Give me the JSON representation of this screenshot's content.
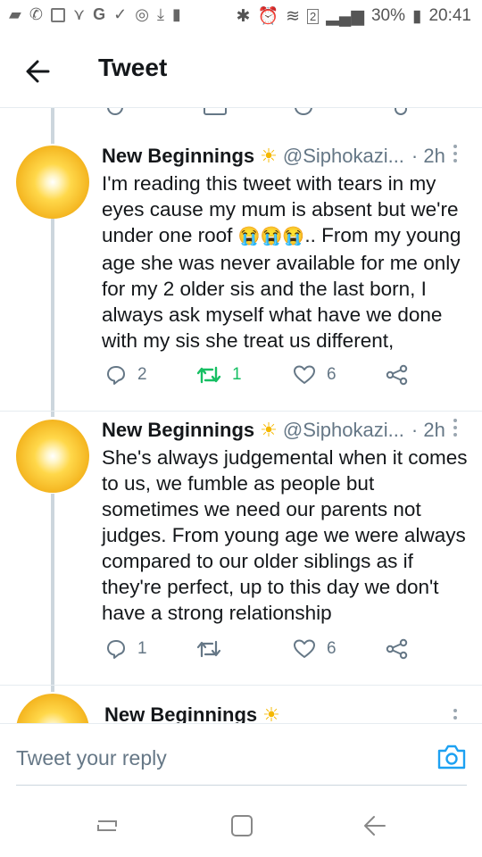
{
  "status_bar": {
    "battery_percent": "30%",
    "time": "20:41",
    "network_badge": "2"
  },
  "header": {
    "title": "Tweet"
  },
  "tweets": [
    {
      "name": "New Beginnings",
      "name_emoji": "☀",
      "handle": "@Siphokazi...",
      "time": "· 2h",
      "text_before_emoji": "I'm reading this tweet with tears in my eyes cause my mum is absent but we're under one roof ",
      "emoji": "😭😭😭",
      "text_after_emoji": ".. From my young age she was never available for me only for my 2 older sis and the last born, I always ask myself what have we done with my sis she treat us different,",
      "reply_count": "2",
      "retweet_count": "1",
      "like_count": "6",
      "retweeted": true
    },
    {
      "name": "New Beginnings",
      "name_emoji": "☀",
      "handle": "@Siphokazi...",
      "time": "· 2h",
      "text": "She's always judgemental when it comes to us, we fumble as people but sometimes we need our parents not judges. From young age we were always compared to our older siblings as if they're perfect, up to this day we don't have a strong relationship",
      "reply_count": "1",
      "retweet_count": "",
      "like_count": "6",
      "retweeted": false
    },
    {
      "name": "New Beginnings",
      "name_emoji": "☀"
    }
  ],
  "reply": {
    "placeholder": "Tweet your reply"
  },
  "icons": {
    "back": "back-arrow-icon",
    "camera": "camera-icon",
    "reply": "reply-icon",
    "retweet": "retweet-icon",
    "like": "heart-icon",
    "share": "share-icon"
  },
  "colors": {
    "retweet_active": "#17bf63",
    "icon_gray": "#657786",
    "link_blue": "#1da1f2"
  }
}
